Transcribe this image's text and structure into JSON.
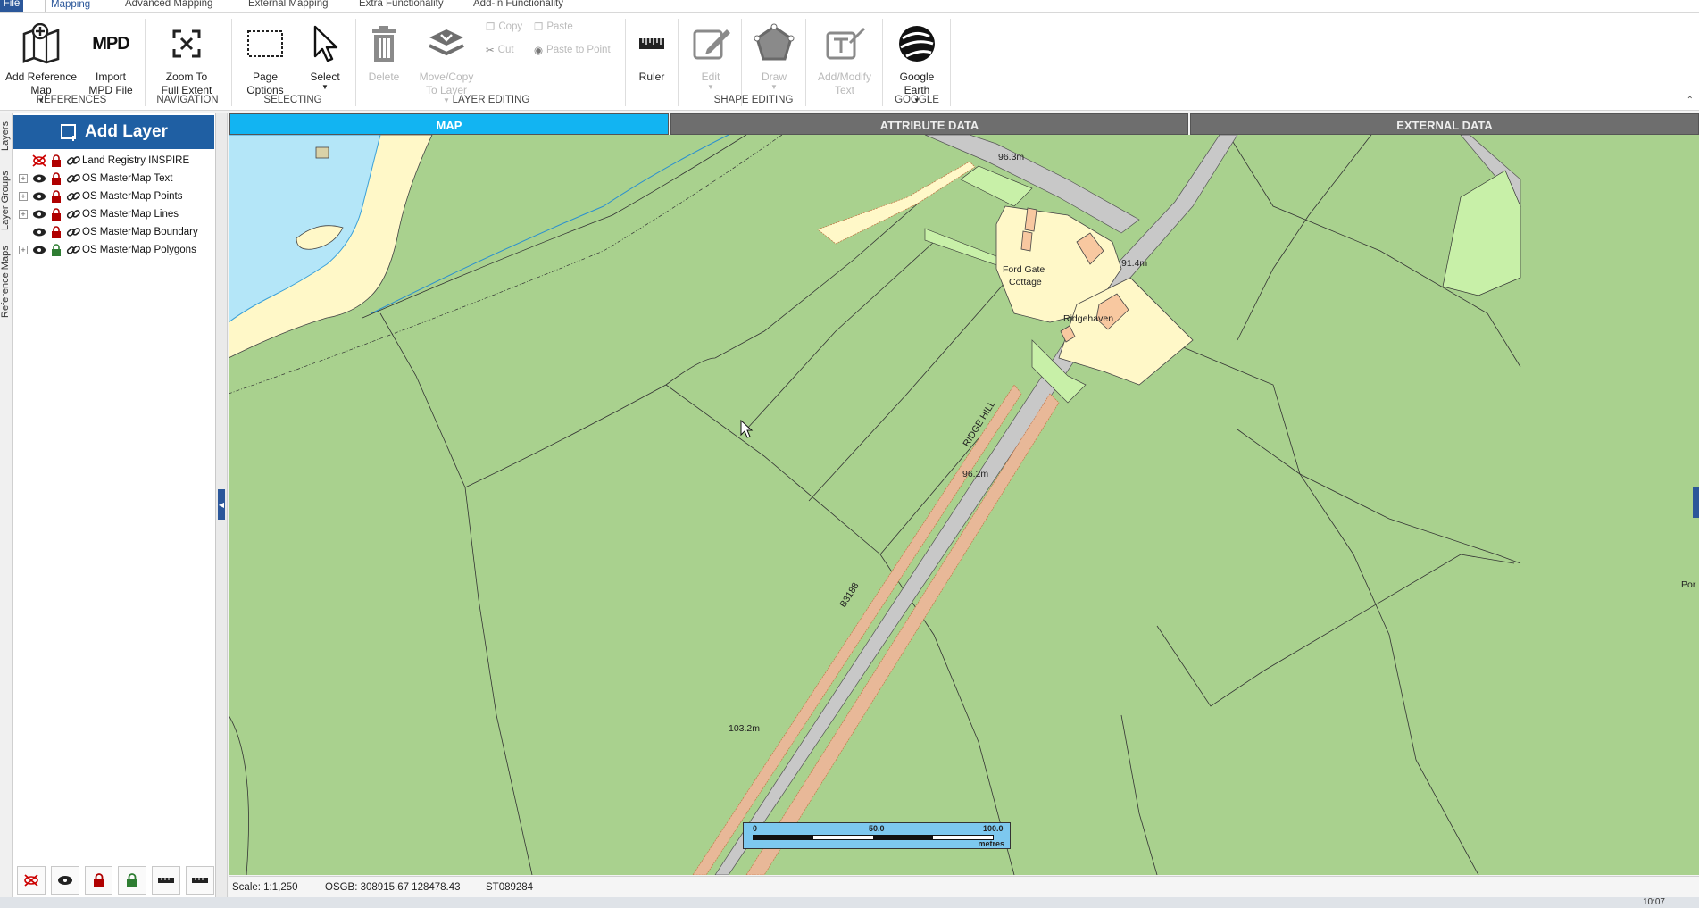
{
  "menu": {
    "tabs": [
      "File",
      "Mapping",
      "Advanced Mapping",
      "External Mapping",
      "Extra Functionality",
      "Add-in Functionality"
    ]
  },
  "ribbon": {
    "buttons": {
      "add_reference_map": "Add Reference\nMap",
      "import_mpd": "Import\nMPD File",
      "mpd_glyph": "MPD",
      "zoom_full_extent": "Zoom To\nFull Extent",
      "page_options": "Page\nOptions",
      "select": "Select",
      "delete": "Delete",
      "move_copy": "Move/Copy\nTo Layer",
      "copy": "Copy",
      "paste": "Paste",
      "cut": "Cut",
      "paste_to_point": "Paste to Point",
      "ruler": "Ruler",
      "edit": "Edit",
      "draw": "Draw",
      "add_modify_text": "Add/Modify\nText",
      "google_earth": "Google\nEarth"
    },
    "groups": {
      "references": "REFERENCES",
      "navigation": "NAVIGATION",
      "selecting": "SELECTING",
      "layer_editing": "LAYER EDITING",
      "shape_editing": "SHAPE EDITING",
      "google": "GOOGLE"
    }
  },
  "side_tabs": [
    "Layers",
    "Layer Groups",
    "Reference Maps"
  ],
  "layer_panel": {
    "add_layer_label": "Add Layer",
    "layers": [
      "Land Registry INSPIRE",
      "OS MasterMap Text",
      "OS MasterMap Points",
      "OS MasterMap Lines",
      "OS MasterMap Boundary",
      "OS MasterMap Polygons"
    ]
  },
  "view_tabs": [
    "MAP",
    "ATTRIBUTE DATA",
    "EXTERNAL DATA"
  ],
  "map": {
    "labels": {
      "height_1": "96.3m",
      "height_2": "91.4m",
      "height_3": "96.2m",
      "height_4": "103.2m",
      "house_1_line1": "Ford Gate",
      "house_1_line2": "Cottage",
      "house_2": "Ridgehaven",
      "road_name": "RIDGE HILL",
      "road_number": "B3188",
      "edge_text": "Por"
    },
    "scalebar": {
      "ticks": [
        "0",
        "50.0",
        "100.0"
      ],
      "unit": "metres"
    },
    "colors": {
      "field": "#a9d18e",
      "water": "#b4e6f8",
      "garden": "#fff8c8",
      "building": "#f8c8a0",
      "road": "#c8c8c8"
    }
  },
  "status": {
    "scale": "Scale: 1:1,250",
    "coords": "OSGB: 308915.67  128478.43",
    "grid_ref": "ST089284"
  },
  "taskbar": {
    "clock": "10:07"
  }
}
